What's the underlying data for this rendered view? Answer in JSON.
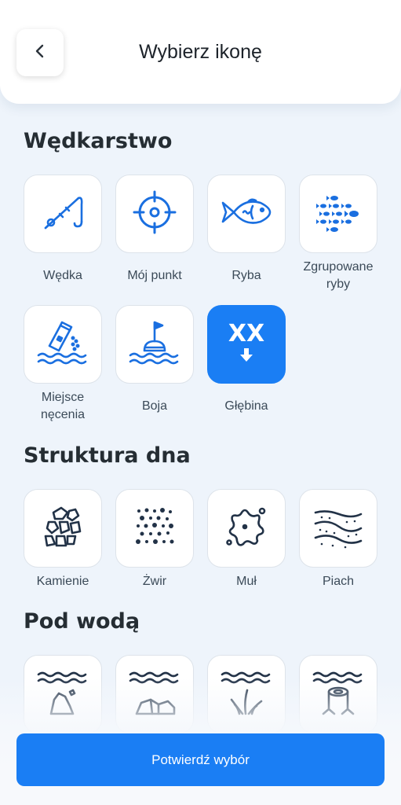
{
  "header": {
    "title": "Wybierz ikonę",
    "back_icon": "chevron-left-icon"
  },
  "sections": [
    {
      "title": "Wędkarstwo"
    },
    {
      "title": "Struktura dna"
    },
    {
      "title": "Pod wodą"
    }
  ],
  "fishing": [
    {
      "label": "Wędka",
      "icon": "fishing-rod-icon"
    },
    {
      "label": "Mój punkt",
      "icon": "crosshair-icon"
    },
    {
      "label": "Ryba",
      "icon": "fish-icon"
    },
    {
      "label_line1": "Zgrupowane",
      "label_line2": "ryby",
      "icon": "fish-school-icon"
    },
    {
      "label_line1": "Miejsce",
      "label_line2": "nęcenia",
      "icon": "bait-spot-icon"
    },
    {
      "label": "Boja",
      "icon": "buoy-icon"
    },
    {
      "label": "Głębina",
      "icon": "depth-icon",
      "selected": true,
      "badge_text": "XX"
    }
  ],
  "bottom": [
    {
      "label": "Kamienie",
      "icon": "stones-icon"
    },
    {
      "label": "Żwir",
      "icon": "gravel-icon"
    },
    {
      "label": "Muł",
      "icon": "mud-icon"
    },
    {
      "label": "Piach",
      "icon": "sand-icon"
    }
  ],
  "underwater": [
    {
      "icon": "underwater-rock-icon"
    },
    {
      "icon": "underwater-boulder-icon"
    },
    {
      "icon": "underwater-weeds-icon"
    },
    {
      "icon": "underwater-stump-icon"
    }
  ],
  "footer": {
    "confirm_label": "Potwierdź wybór"
  },
  "colors": {
    "accent": "#1a7ef4",
    "icon_blue": "#1a6fe0",
    "icon_dark": "#223247",
    "background": "#eef4fb"
  }
}
